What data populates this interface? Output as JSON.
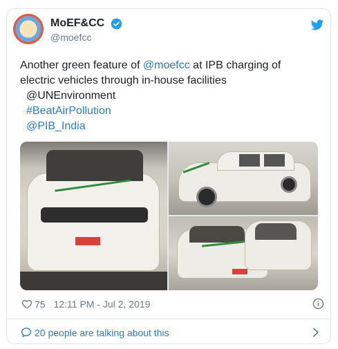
{
  "account": {
    "display_name": "MoEF&CC",
    "handle": "@moefcc"
  },
  "tweet": {
    "text_part1": "Another green feature of ",
    "mention_self": "@moefcc",
    "text_part2": " at IPB charging of",
    "text_line2": "electric vehicles through in-house facilities",
    "mention_un": "@UNEnvironment",
    "hashtag": "#BeatAirPollution",
    "mention_pib": "@PIB_India"
  },
  "meta": {
    "likes": "75",
    "timestamp": "12:11 PM - Jul 2, 2019"
  },
  "footer": {
    "talking_label": "20 people are talking about this"
  },
  "colors": {
    "link": "#2b7bb9",
    "text": "#1c2022",
    "muted": "#697882",
    "border": "#e1e8ed",
    "twitter_blue": "#1da1f2"
  }
}
